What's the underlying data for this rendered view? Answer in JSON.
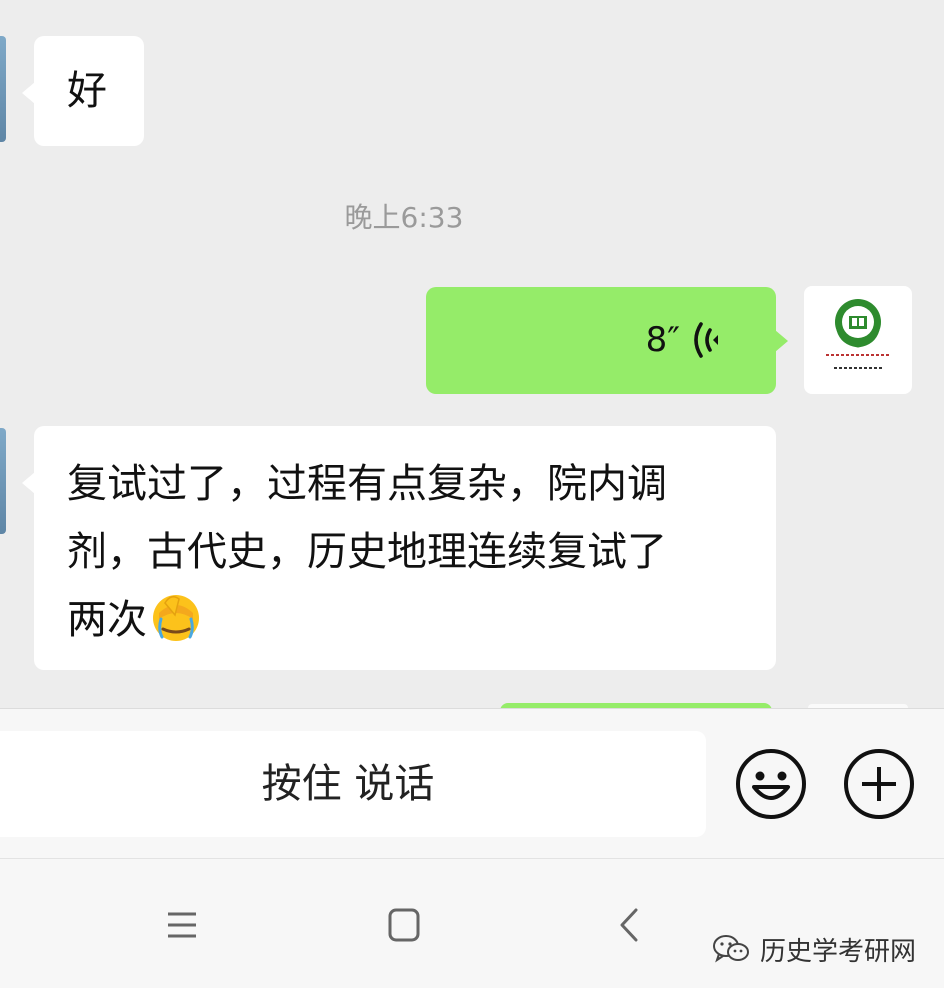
{
  "chat": {
    "messages": [
      {
        "side": "incoming",
        "type": "text",
        "text": "好"
      },
      {
        "type": "timestamp",
        "text": "晚上6:33"
      },
      {
        "side": "outgoing",
        "type": "voice",
        "duration": "8″"
      },
      {
        "side": "incoming",
        "type": "text",
        "text": "复试过了，过程有点复杂，院内调\n剂，古代史，历史地理连续复试了\n两次",
        "emoji": "facepalm-emoji"
      }
    ]
  },
  "input_bar": {
    "hold_to_talk_label": "按住 说话",
    "emoji_icon": "smiley-face-icon",
    "plus_icon": "plus-circle-icon"
  },
  "nav_bar": {
    "menu_icon": "menu-icon",
    "home_icon": "home-square-icon",
    "back_icon": "back-chevron-icon"
  },
  "watermark": {
    "text": "历史学考研网"
  },
  "colors": {
    "background": "#ededed",
    "incoming_bubble": "#ffffff",
    "outgoing_bubble": "#95ec69",
    "timestamp": "#9a9a9a",
    "avatar_green": "#2e8b2e"
  }
}
